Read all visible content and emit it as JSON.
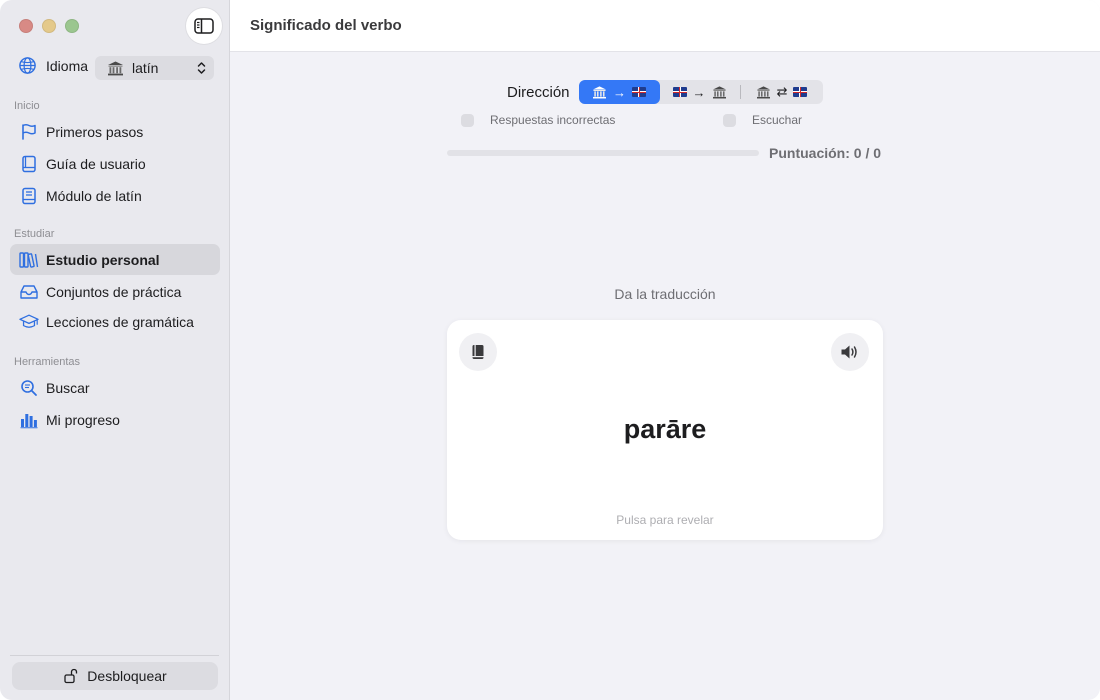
{
  "window": {
    "title": "Significado del verbo"
  },
  "sidebar": {
    "language_label": "Idioma",
    "language_value": "latín",
    "sections": [
      {
        "title": "Inicio",
        "items": [
          {
            "label": "Primeros pasos",
            "icon": "flag-icon"
          },
          {
            "label": "Guía de usuario",
            "icon": "book-icon"
          },
          {
            "label": "Módulo de latín",
            "icon": "book-icon"
          }
        ]
      },
      {
        "title": "Estudiar",
        "items": [
          {
            "label": "Estudio personal",
            "icon": "books-icon",
            "active": true
          },
          {
            "label": "Conjuntos de práctica",
            "icon": "tray-icon"
          },
          {
            "label": "Lecciones de gramática",
            "icon": "graduation-cap-icon"
          }
        ]
      },
      {
        "title": "Herramientas",
        "items": [
          {
            "label": "Buscar",
            "icon": "search-icon"
          },
          {
            "label": "Mi progreso",
            "icon": "chart-bars-icon"
          }
        ]
      }
    ],
    "unlock_label": "Desbloquear"
  },
  "main": {
    "direction_label": "Dirección",
    "direction_options": [
      {
        "from": "latin-temple-icon",
        "arrow": "→",
        "to": "uk-flag-icon",
        "selected": true
      },
      {
        "from": "uk-flag-icon",
        "arrow": "→",
        "to": "latin-temple-icon",
        "selected": false
      },
      {
        "from": "latin-temple-icon",
        "arrow": "⇄",
        "to": "uk-flag-icon",
        "selected": false
      }
    ],
    "options": {
      "wrong_answers_label": "Respuestas incorrectas",
      "listen_label": "Escuchar"
    },
    "progress": 0,
    "score_text": "Puntuación: 0 / 0",
    "prompt": "Da la traducción",
    "card": {
      "word": "parāre",
      "hint": "Pulsa para revelar"
    }
  },
  "colors": {
    "accent": "#3478f6",
    "sidebar_bg": "#e9e9ee",
    "main_bg": "#f2f2f7",
    "icon_blue": "#2f6fe0"
  }
}
